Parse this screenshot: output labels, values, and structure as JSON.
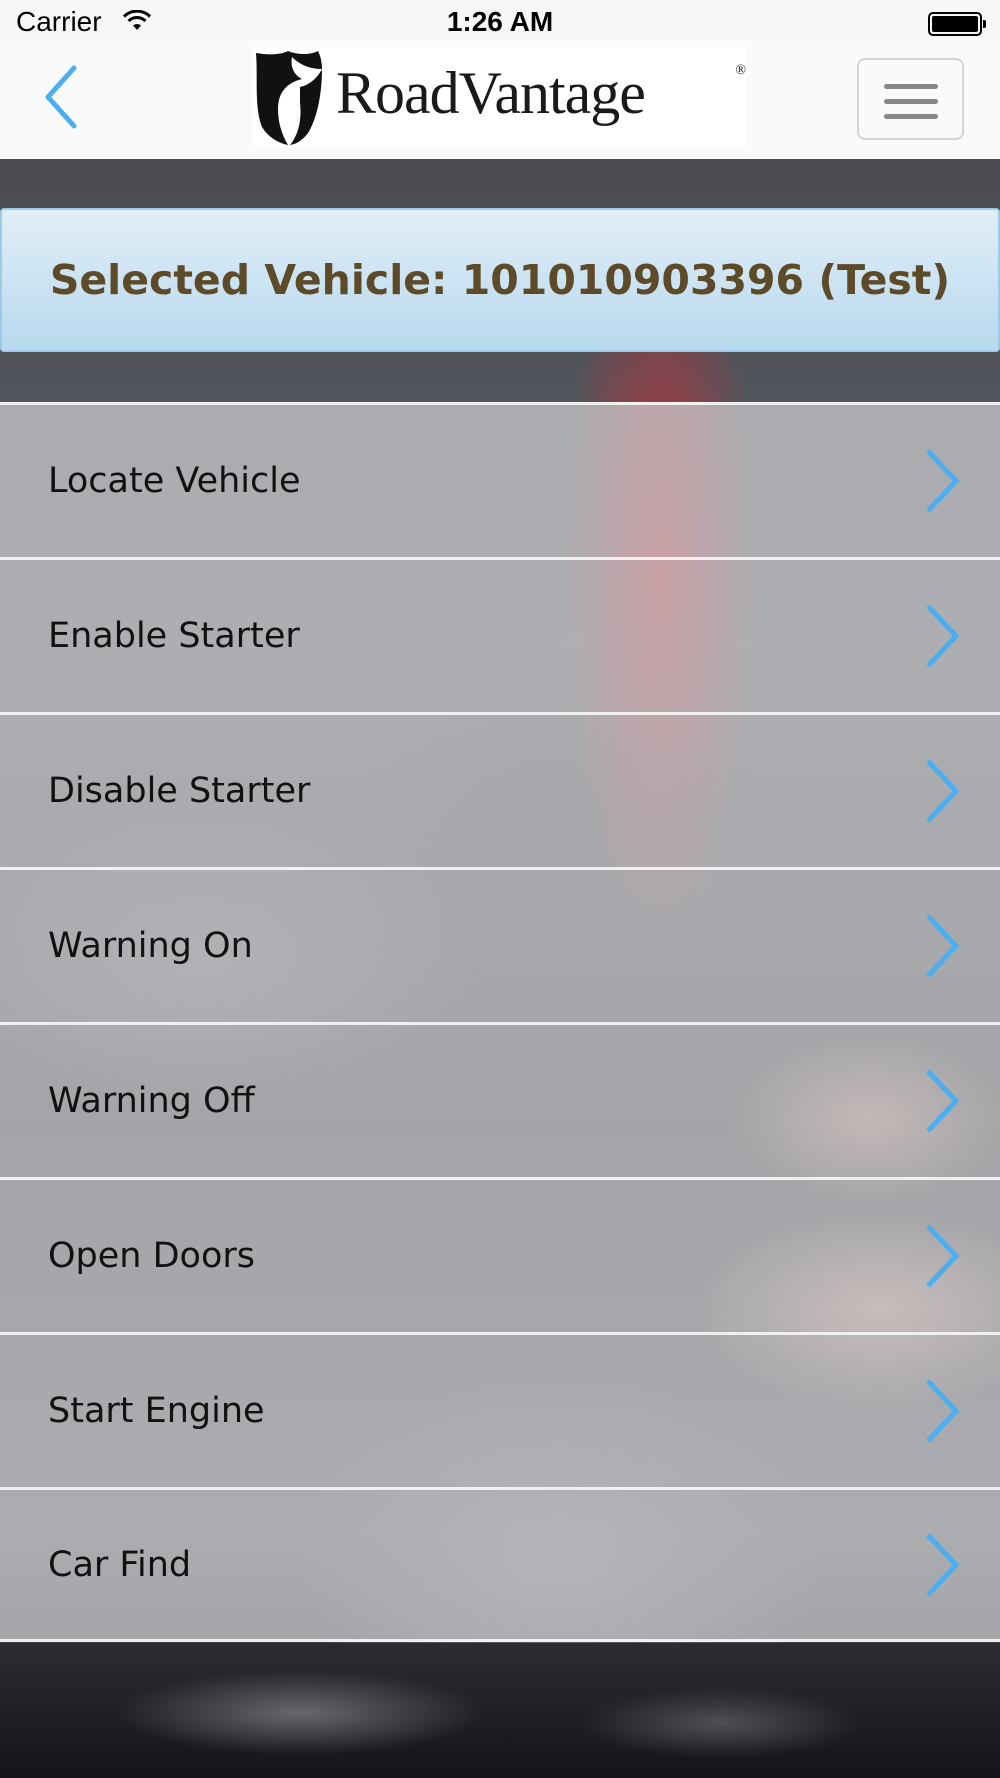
{
  "status_bar": {
    "carrier": "Carrier",
    "time": "1:26 AM"
  },
  "header": {
    "logo_text": "RoadVantage",
    "back_icon": "chevron-left-icon",
    "menu_icon": "hamburger-icon"
  },
  "vehicle_banner": {
    "text": "Selected Vehicle: 101010903396 (Test)"
  },
  "menu": {
    "items": [
      {
        "label": "Locate Vehicle"
      },
      {
        "label": "Enable Starter"
      },
      {
        "label": "Disable Starter"
      },
      {
        "label": "Warning On"
      },
      {
        "label": "Warning Off"
      },
      {
        "label": "Open Doors"
      },
      {
        "label": "Start Engine"
      },
      {
        "label": "Car Find"
      }
    ]
  },
  "colors": {
    "accent": "#4aaef0",
    "banner_text": "#5d4a28",
    "banner_bg": "#c9e3f3"
  }
}
